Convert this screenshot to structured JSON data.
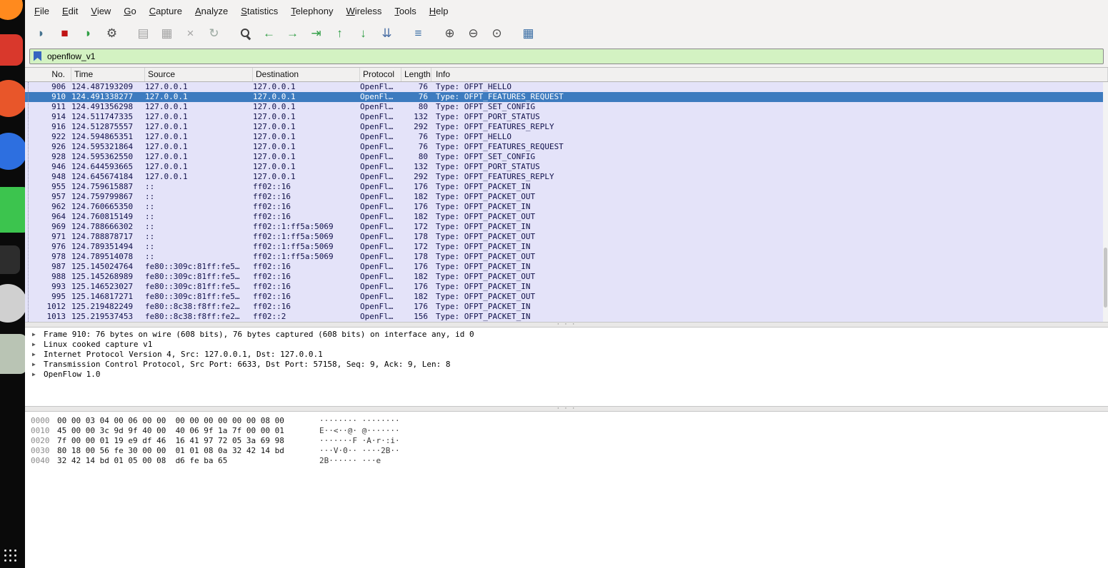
{
  "menu": {
    "items": [
      "File",
      "Edit",
      "View",
      "Go",
      "Capture",
      "Analyze",
      "Statistics",
      "Telephony",
      "Wireless",
      "Tools",
      "Help"
    ]
  },
  "toolbar": {
    "buttons": [
      {
        "name": "start-capture",
        "glyph": "◗",
        "color": "#46738f"
      },
      {
        "name": "stop-capture",
        "glyph": "■",
        "color": "#c01414"
      },
      {
        "name": "restart-capture",
        "glyph": "◗",
        "color": "#2f9e44"
      },
      {
        "name": "capture-options",
        "glyph": "⚙",
        "color": "#4a4a4a"
      },
      {
        "name": "open-capture-file",
        "glyph": "▤",
        "color": "#a3a3a3",
        "gap": true
      },
      {
        "name": "save-capture-file",
        "glyph": "▦",
        "color": "#a3a3a3"
      },
      {
        "name": "close-capture-file",
        "glyph": "×",
        "color": "#a3a3a3"
      },
      {
        "name": "reload-capture-file",
        "glyph": "↻",
        "color": "#9aa8a0"
      },
      {
        "name": "find-packet",
        "icon": "magnifier",
        "glyph": "",
        "color": "#3f3f3f",
        "gap": true
      },
      {
        "name": "previous-packet",
        "glyph": "←",
        "color": "#2f9e44"
      },
      {
        "name": "next-packet",
        "glyph": "→",
        "color": "#2f9e44"
      },
      {
        "name": "go-to-packet",
        "glyph": "⇥",
        "color": "#2f9e44"
      },
      {
        "name": "first-packet",
        "glyph": "↑",
        "color": "#2f9e44"
      },
      {
        "name": "last-packet",
        "glyph": "↓",
        "color": "#2f9e44"
      },
      {
        "name": "auto-scroll",
        "glyph": "⇊",
        "color": "#4a6fa5"
      },
      {
        "name": "colorize-packets",
        "glyph": "≡",
        "color": "#3a6ea5",
        "gap": true
      },
      {
        "name": "zoom-in",
        "glyph": "⊕",
        "color": "#4a4a4a",
        "gap": true
      },
      {
        "name": "zoom-out",
        "glyph": "⊖",
        "color": "#4a4a4a"
      },
      {
        "name": "zoom-original",
        "glyph": "⊙",
        "color": "#4a4a4a"
      },
      {
        "name": "resize-columns",
        "glyph": "▦",
        "color": "#3a6ea5",
        "gap": true
      }
    ]
  },
  "filter": {
    "value": "openflow_v1"
  },
  "packet_list": {
    "columns": [
      "No.",
      "Time",
      "Source",
      "Destination",
      "Protocol",
      "Length",
      "Info"
    ],
    "selected_row": 1,
    "rows": [
      [
        "906",
        "124.487193209",
        "127.0.0.1",
        "127.0.0.1",
        "OpenFl…",
        "76",
        "Type: OFPT_HELLO"
      ],
      [
        "910",
        "124.491338277",
        "127.0.0.1",
        "127.0.0.1",
        "OpenFl…",
        "76",
        "Type: OFPT_FEATURES_REQUEST"
      ],
      [
        "911",
        "124.491356298",
        "127.0.0.1",
        "127.0.0.1",
        "OpenFl…",
        "80",
        "Type: OFPT_SET_CONFIG"
      ],
      [
        "914",
        "124.511747335",
        "127.0.0.1",
        "127.0.0.1",
        "OpenFl…",
        "132",
        "Type: OFPT_PORT_STATUS"
      ],
      [
        "916",
        "124.512875557",
        "127.0.0.1",
        "127.0.0.1",
        "OpenFl…",
        "292",
        "Type: OFPT_FEATURES_REPLY"
      ],
      [
        "922",
        "124.594865351",
        "127.0.0.1",
        "127.0.0.1",
        "OpenFl…",
        "76",
        "Type: OFPT_HELLO"
      ],
      [
        "926",
        "124.595321864",
        "127.0.0.1",
        "127.0.0.1",
        "OpenFl…",
        "76",
        "Type: OFPT_FEATURES_REQUEST"
      ],
      [
        "928",
        "124.595362550",
        "127.0.0.1",
        "127.0.0.1",
        "OpenFl…",
        "80",
        "Type: OFPT_SET_CONFIG"
      ],
      [
        "946",
        "124.644593665",
        "127.0.0.1",
        "127.0.0.1",
        "OpenFl…",
        "132",
        "Type: OFPT_PORT_STATUS"
      ],
      [
        "948",
        "124.645674184",
        "127.0.0.1",
        "127.0.0.1",
        "OpenFl…",
        "292",
        "Type: OFPT_FEATURES_REPLY"
      ],
      [
        "955",
        "124.759615887",
        "::",
        "ff02::16",
        "OpenFl…",
        "176",
        "Type: OFPT_PACKET_IN"
      ],
      [
        "957",
        "124.759799867",
        "::",
        "ff02::16",
        "OpenFl…",
        "182",
        "Type: OFPT_PACKET_OUT"
      ],
      [
        "962",
        "124.760665350",
        "::",
        "ff02::16",
        "OpenFl…",
        "176",
        "Type: OFPT_PACKET_IN"
      ],
      [
        "964",
        "124.760815149",
        "::",
        "ff02::16",
        "OpenFl…",
        "182",
        "Type: OFPT_PACKET_OUT"
      ],
      [
        "969",
        "124.788666302",
        "::",
        "ff02::1:ff5a:5069",
        "OpenFl…",
        "172",
        "Type: OFPT_PACKET_IN"
      ],
      [
        "971",
        "124.788878717",
        "::",
        "ff02::1:ff5a:5069",
        "OpenFl…",
        "178",
        "Type: OFPT_PACKET_OUT"
      ],
      [
        "976",
        "124.789351494",
        "::",
        "ff02::1:ff5a:5069",
        "OpenFl…",
        "172",
        "Type: OFPT_PACKET_IN"
      ],
      [
        "978",
        "124.789514078",
        "::",
        "ff02::1:ff5a:5069",
        "OpenFl…",
        "178",
        "Type: OFPT_PACKET_OUT"
      ],
      [
        "987",
        "125.145024764",
        "fe80::309c:81ff:fe5…",
        "ff02::16",
        "OpenFl…",
        "176",
        "Type: OFPT_PACKET_IN"
      ],
      [
        "988",
        "125.145268989",
        "fe80::309c:81ff:fe5…",
        "ff02::16",
        "OpenFl…",
        "182",
        "Type: OFPT_PACKET_OUT"
      ],
      [
        "993",
        "125.146523027",
        "fe80::309c:81ff:fe5…",
        "ff02::16",
        "OpenFl…",
        "176",
        "Type: OFPT_PACKET_IN"
      ],
      [
        "995",
        "125.146817271",
        "fe80::309c:81ff:fe5…",
        "ff02::16",
        "OpenFl…",
        "182",
        "Type: OFPT_PACKET_OUT"
      ],
      [
        "1012",
        "125.219482249",
        "fe80::8c38:f8ff:fe2…",
        "ff02::16",
        "OpenFl…",
        "176",
        "Type: OFPT_PACKET_IN"
      ],
      [
        "1013",
        "125.219537453",
        "fe80::8c38:f8ff:fe2…",
        "ff02::2",
        "OpenFl…",
        "156",
        "Type: OFPT_PACKET_IN"
      ]
    ]
  },
  "details": {
    "lines": [
      "Frame 910: 76 bytes on wire (608 bits), 76 bytes captured (608 bits) on interface any, id 0",
      "Linux cooked capture v1",
      "Internet Protocol Version 4, Src: 127.0.0.1, Dst: 127.0.0.1",
      "Transmission Control Protocol, Src Port: 6633, Dst Port: 57158, Seq: 9, Ack: 9, Len: 8",
      "OpenFlow 1.0"
    ]
  },
  "hex": {
    "rows": [
      {
        "offset": "0000",
        "bytes": "00 00 03 04 00 06 00 00  00 00 00 00 00 00 08 00",
        "ascii": "········ ········"
      },
      {
        "offset": "0010",
        "bytes": "45 00 00 3c 9d 9f 40 00  40 06 9f 1a 7f 00 00 01",
        "ascii": "E··<··@· @·······"
      },
      {
        "offset": "0020",
        "bytes": "7f 00 00 01 19 e9 df 46  16 41 97 72 05 3a 69 98",
        "ascii": "·······F ·A·r·:i·"
      },
      {
        "offset": "0030",
        "bytes": "80 18 00 56 fe 30 00 00  01 01 08 0a 32 42 14 bd",
        "ascii": "···V·0·· ····2B··"
      },
      {
        "offset": "0040",
        "bytes": "32 42 14 bd 01 05 00 08  d6 fe ba 65",
        "ascii": "2B······ ···e"
      }
    ]
  },
  "dock": {
    "icons": [
      {
        "name": "firefox",
        "color": "#ff8a1e"
      },
      {
        "name": "red-app",
        "color": "#d9382c"
      },
      {
        "name": "orange-app",
        "color": "#e8562a"
      },
      {
        "name": "blue-app",
        "color": "#2d6fe0"
      },
      {
        "name": "green-app",
        "color": "#3cc44e"
      },
      {
        "name": "dark-app",
        "color": "#2d2d2d"
      },
      {
        "name": "gray-app",
        "color": "#d0d0d0"
      },
      {
        "name": "sage-app",
        "color": "#b9c4b4"
      }
    ]
  },
  "colors": {
    "chrome_bg": "#f3f2f1",
    "filter_valid_bg": "#d3f2c2",
    "bookmark_color": "#3566c0",
    "row_bg": "#e4e3f9",
    "row_fg": "#10104a",
    "selected_bg": "#3d7bbf",
    "selected_fg": "#ffffff"
  }
}
